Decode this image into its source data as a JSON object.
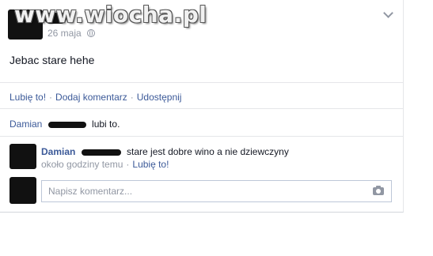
{
  "watermark": "www.wiocha.pl",
  "post": {
    "date": "26 maja",
    "text": "Jebac stare hehe"
  },
  "actions": {
    "like": "Lubię to!",
    "comment": "Dodaj komentarz",
    "share": "Udostępnij",
    "separator": "·"
  },
  "likes": {
    "name": "Damian",
    "suffix": "lubi to."
  },
  "comment": {
    "author": "Damian",
    "text": "stare jest dobre wino a nie dziewczyny",
    "time": "około godziny temu",
    "like": "Lubię to!"
  },
  "comment_box": {
    "placeholder": "Napisz komentarz..."
  }
}
